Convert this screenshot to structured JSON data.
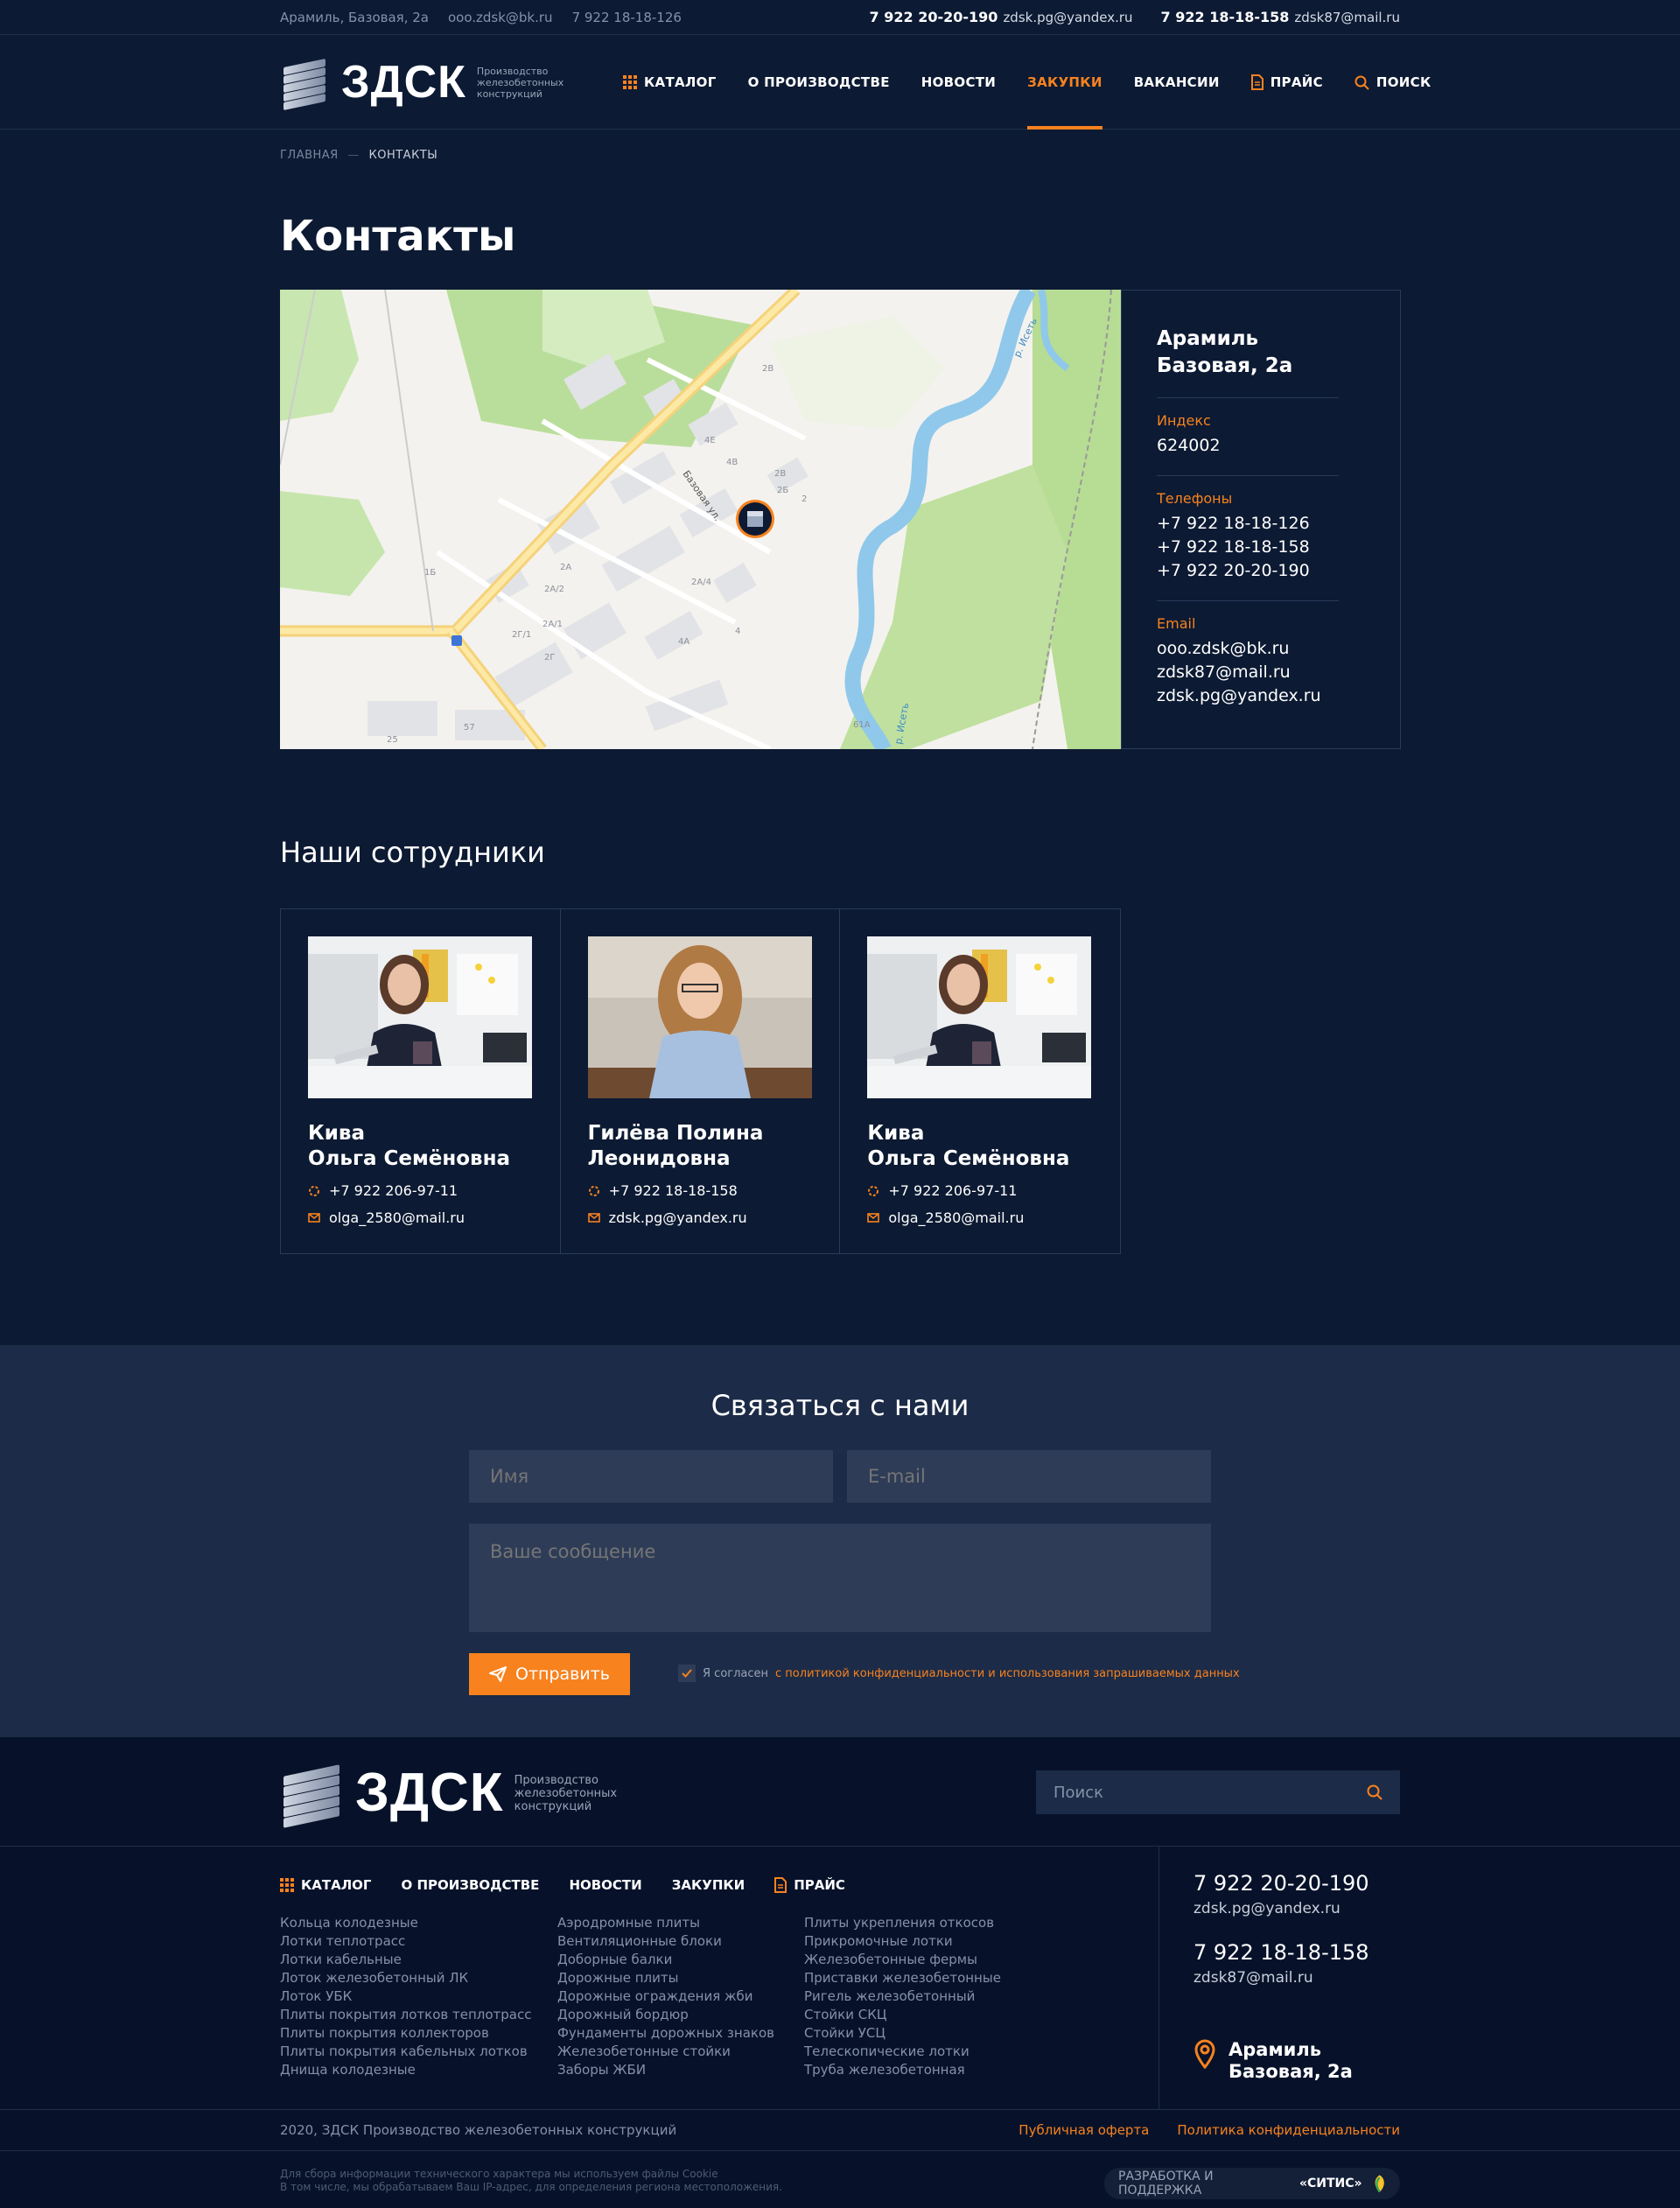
{
  "topbar": {
    "address": "Арамиль, Базовая, 2а",
    "email": "ooo.zdsk@bk.ru",
    "phone": "7 922 18-18-126",
    "contacts": [
      {
        "phone": "7 922 20-20-190",
        "email": "zdsk.pg@yandex.ru"
      },
      {
        "phone": "7 922 18-18-158",
        "email": "zdsk87@mail.ru"
      }
    ]
  },
  "logo": {
    "title": "ЗДСК",
    "subtitle": "Производство железобетонных конструкций"
  },
  "nav": {
    "catalog": "КАТАЛОГ",
    "production": "О ПРОИЗВОДСТВЕ",
    "news": "НОВОСТИ",
    "purchases": "ЗАКУПКИ",
    "vacancies": "ВАКАНСИИ",
    "price": "ПРАЙС",
    "search": "ПОИСК"
  },
  "breadcrumb": {
    "home": "ГЛАВНАЯ",
    "sep": "—",
    "current": "КОНТАКТЫ"
  },
  "page_title": "Контакты",
  "map": {
    "street_label": "Базовая ул.",
    "river_label_1": "р. Исеть",
    "river_label_2": "р. Исеть",
    "numbers": [
      "2В",
      "4Е",
      "4В",
      "2В",
      "2Б",
      "2",
      "4Б",
      "2А",
      "2А/2",
      "2А/4",
      "2А/1",
      "2Г/1",
      "2Г",
      "4А",
      "4",
      "1Б",
      "57",
      "25",
      "61А"
    ]
  },
  "info": {
    "address_line1": "Арамиль",
    "address_line2": "Базовая, 2а",
    "index_label": "Индекс",
    "index": "624002",
    "phones_label": "Телефоны",
    "phones": [
      "+7 922 18-18-126",
      "+7 922 18-18-158",
      "+7 922 20-20-190"
    ],
    "email_label": "Email",
    "emails": [
      "ooo.zdsk@bk.ru",
      "zdsk87@mail.ru",
      "zdsk.pg@yandex.ru"
    ]
  },
  "staff_title": "Наши сотрудники",
  "staff": [
    {
      "name1": "Кива",
      "name2": "Ольга Семёновна",
      "phone": "+7 922 206-97-11",
      "email": "olga_2580@mail.ru"
    },
    {
      "name1": "Гилёва Полина",
      "name2": "Леонидовна",
      "phone": "+7 922 18-18-158",
      "email": "zdsk.pg@yandex.ru"
    },
    {
      "name1": "Кива",
      "name2": "Ольга Семёновна",
      "phone": "+7 922 206-97-11",
      "email": "olga_2580@mail.ru"
    }
  ],
  "contact_form": {
    "title": "Связаться с нами",
    "name_placeholder": "Имя",
    "email_placeholder": "E-mail",
    "message_placeholder": "Ваше сообщение",
    "send": "Отправить",
    "agree_text": "Я согласен",
    "agree_link": "с политикой конфиденциальности и использования запрашиваемых данных"
  },
  "footer": {
    "search_placeholder": "Поиск",
    "nav": {
      "catalog": "КАТАЛОГ",
      "production": "О ПРОИЗВОДСТВЕ",
      "news": "НОВОСТИ",
      "purchases": "ЗАКУПКИ",
      "price": "ПРАЙС"
    },
    "col1": [
      "Кольца колодезные",
      "Лотки теплотрасс",
      "Лотки кабельные",
      "Лоток железобетонный ЛК",
      "Лоток УБК",
      "Плиты покрытия лотков теплотрасс",
      "Плиты покрытия коллекторов",
      "Плиты покрытия кабельных лотков",
      "Днища колодезные"
    ],
    "col2": [
      "Аэродромные плиты",
      "Вентиляционные блоки",
      "Доборные балки",
      "Дорожные плиты",
      "Дорожные ограждения жби",
      "Дорожный бордюр",
      "Фундаменты дорожных знаков",
      "Железобетонные стойки",
      "Заборы ЖБИ"
    ],
    "col3": [
      "Плиты укрепления откосов",
      "Прикромочные лотки",
      "Железобетонные фермы",
      "Приставки железобетонные",
      "Ригель железобетонный",
      "Стойки СКЦ",
      "Стойки УСЦ",
      "Телескопические лотки",
      "Труба железобетонная"
    ],
    "phone1": "7 922 20-20-190",
    "email1": "zdsk.pg@yandex.ru",
    "phone2": "7 922 18-18-158",
    "email2": "zdsk87@mail.ru",
    "address_line1": "Арамиль",
    "address_line2": "Базовая, 2а",
    "copyright": "2020, ЗДСК Производство железобетонных конструкций",
    "offer": "Публичная оферта",
    "privacy": "Политика конфиденциальности",
    "cookie_line1": "Для сбора информации технического характера мы используем файлы Cookie",
    "cookie_line2": "В том числе, мы обрабатываем Ваш IP-адрес, для определения региона местоположения.",
    "dev_text": "РАЗРАБОТКА И ПОДДЕРЖКА",
    "dev_name": "«СИТИС»"
  },
  "colors": {
    "accent": "#f7821e",
    "bg": "#0c1a33",
    "footer_bg": "#07122a",
    "form_bg": "#1c2b47"
  }
}
